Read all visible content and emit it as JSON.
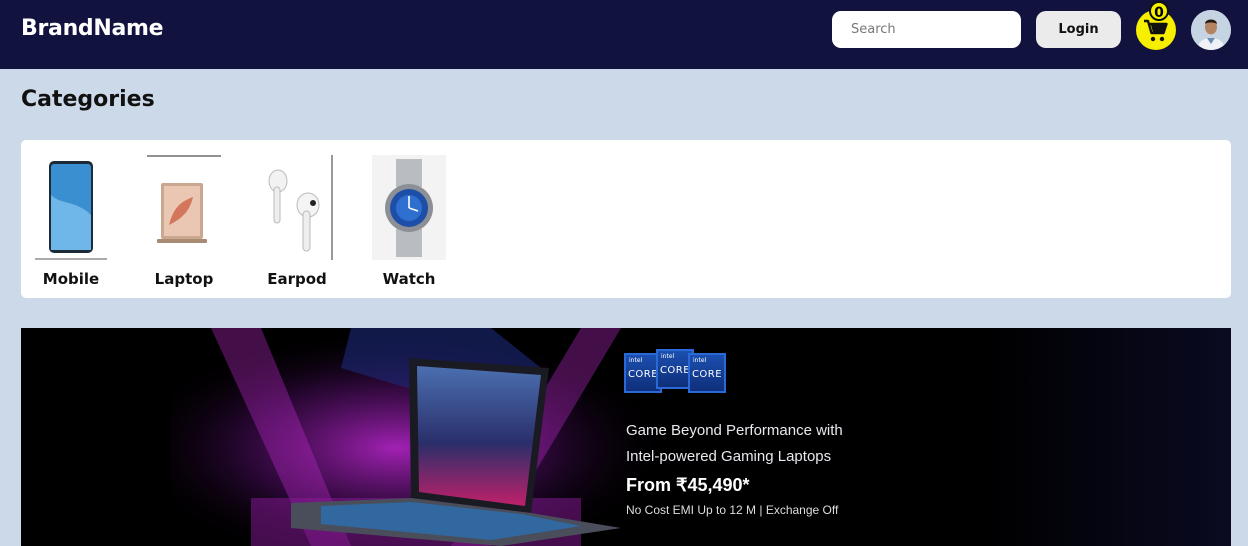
{
  "header": {
    "brand": "BrandName",
    "search_placeholder": "Search",
    "login_label": "Login",
    "cart_count": "0",
    "cart_icon": "shopping-cart-icon",
    "avatar": "user-avatar",
    "colors": {
      "background": "#12123f",
      "cart": "#f7ef00"
    }
  },
  "categories": {
    "title": "Categories",
    "items": [
      {
        "label": "Mobile",
        "icon": "mobile-phone-image"
      },
      {
        "label": "Laptop",
        "icon": "laptop-image"
      },
      {
        "label": "Earpod",
        "icon": "earpods-image"
      },
      {
        "label": "Watch",
        "icon": "wristwatch-image"
      }
    ]
  },
  "banner": {
    "badges": [
      "intel CORE i7",
      "intel CORE i9",
      "intel CORE i5"
    ],
    "headline_line1": "Game Beyond Performance with",
    "headline_line2": "Intel-powered Gaming Laptops",
    "price": "From ₹45,490*",
    "emi": "No Cost EMI Up to 12 M | Exchange Off"
  }
}
